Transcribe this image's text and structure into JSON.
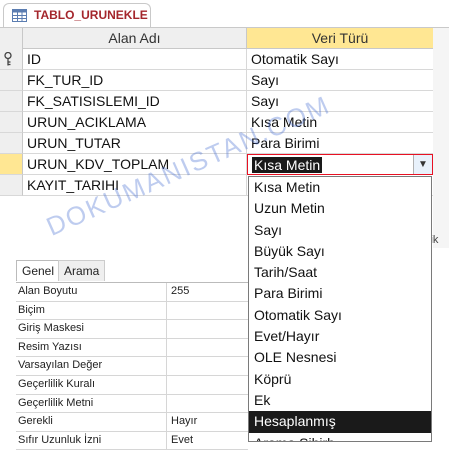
{
  "tab": {
    "title": "TABLO_URUNEKLE",
    "icon": "table-icon"
  },
  "grid": {
    "headers": {
      "name": "Alan Adı",
      "type": "Veri Türü"
    },
    "rows": [
      {
        "name": "ID",
        "type": "Otomatik Sayı",
        "key": true
      },
      {
        "name": "FK_TUR_ID",
        "type": "Sayı"
      },
      {
        "name": "FK_SATISISLEMI_ID",
        "type": "Sayı"
      },
      {
        "name": "URUN_ACIKLAMA",
        "type": "Kısa Metin"
      },
      {
        "name": "URUN_TUTAR",
        "type": "Para Birimi"
      },
      {
        "name": "URUN_KDV_TOPLAM",
        "type": "Kısa Metin",
        "active": true
      },
      {
        "name": "KAYIT_TARIHI",
        "type": ""
      }
    ]
  },
  "side_text": "lik",
  "properties": {
    "tabs": [
      "Genel",
      "Arama"
    ],
    "rows": [
      {
        "label": "Alan Boyutu",
        "value": "255"
      },
      {
        "label": "Biçim",
        "value": ""
      },
      {
        "label": "Giriş Maskesi",
        "value": ""
      },
      {
        "label": "Resim Yazısı",
        "value": ""
      },
      {
        "label": "Varsayılan Değer",
        "value": ""
      },
      {
        "label": "Geçerlilik Kuralı",
        "value": ""
      },
      {
        "label": "Geçerlilik Metni",
        "value": ""
      },
      {
        "label": "Gerekli",
        "value": "Hayır"
      },
      {
        "label": "Sıfır Uzunluk İzni",
        "value": "Evet"
      }
    ]
  },
  "dropdown": {
    "items": [
      "Kısa Metin",
      "Uzun Metin",
      "Sayı",
      "Büyük Sayı",
      "Tarih/Saat",
      "Para Birimi",
      "Otomatik Sayı",
      "Evet/Hayır",
      "OLE Nesnesi",
      "Köprü",
      "Ek",
      "Hesaplanmış",
      "Arama Sihirb"
    ],
    "highlighted": "Hesaplanmış"
  },
  "watermark": "DOKUMANISTAN.COM",
  "colors": {
    "tab_title": "#a4262c",
    "header_highlight": "#ffe793",
    "combo_border": "#e81123"
  }
}
